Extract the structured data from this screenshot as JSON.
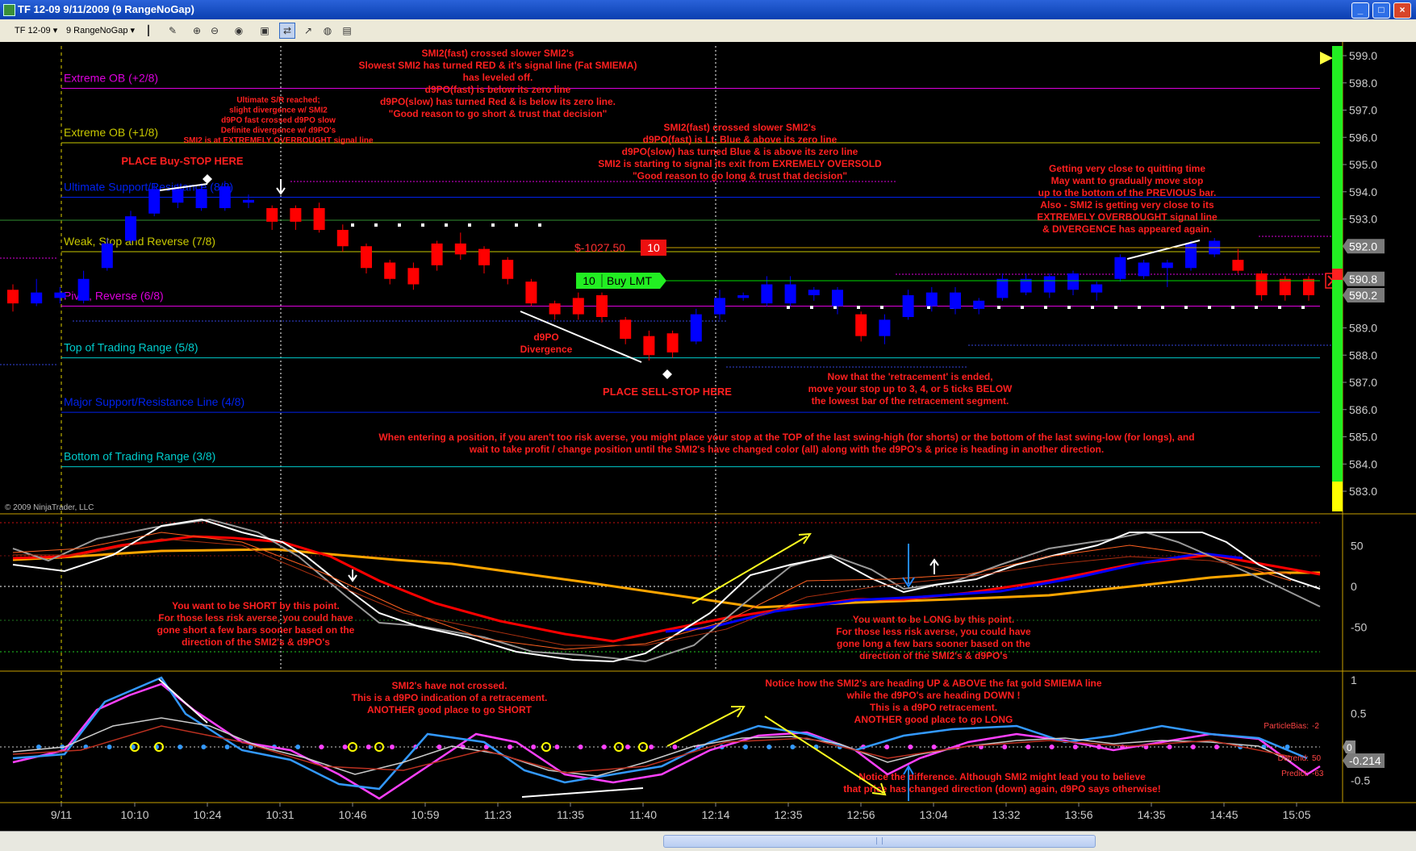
{
  "window": {
    "title": "TF 12-09  9/11/2009 (9 RangeNoGap)"
  },
  "toolbar": {
    "instrument": "TF 12-09",
    "period": "9 RangeNoGap"
  },
  "copyright": "© 2009 NinjaTrader, LLC",
  "colors": {
    "bull": "#0000ff",
    "bear": "#ff0000",
    "annotation": "#ff2020",
    "orange_ma": "#ffa500"
  },
  "price_axis": {
    "ticks": [
      "599.0",
      "598.0",
      "597.0",
      "596.0",
      "595.0",
      "594.0",
      "593.0",
      "592.0",
      "591.0",
      "590.0",
      "589.0",
      "588.0",
      "587.0",
      "586.0",
      "585.0",
      "584.0",
      "583.0"
    ],
    "min": 582.5,
    "max": 599.5
  },
  "price_tags": [
    {
      "label": "592.0",
      "price": 592.0,
      "style": "gray"
    },
    {
      "label": "590.8",
      "price": 590.8,
      "style": "gray"
    },
    {
      "label": "590.2",
      "price": 590.2,
      "style": "gray"
    }
  ],
  "murrey_lines": [
    {
      "label": "Extreme OB (+2/8)",
      "price": 597.8,
      "color": "#dd00dd"
    },
    {
      "label": "Extreme OB (+1/8)",
      "price": 595.8,
      "color": "#c8c800"
    },
    {
      "label": "Ultimate Support/Resistance (8/8)",
      "price": 593.8,
      "color": "#0022ee"
    },
    {
      "label": "Weak, Stop and Reverse (7/8)",
      "price": 591.8,
      "color": "#c8c800"
    },
    {
      "label": "Pivot, Reverse (6/8)",
      "price": 589.8,
      "color": "#dd00dd"
    },
    {
      "label": "Top of Trading Range (5/8)",
      "price": 587.9,
      "color": "#00cccc"
    },
    {
      "label": "Major Support/Resistance Line (4/8)",
      "price": 585.9,
      "color": "#0022ee"
    },
    {
      "label": "Bottom of Trading Range (3/8)",
      "price": 583.9,
      "color": "#00cccc"
    }
  ],
  "order_markers": {
    "position_pnl": "$-1027.50",
    "position_qty": "10",
    "order_qty": "10",
    "order_label": "Buy LMT"
  },
  "time_axis": [
    "9/11",
    "10:10",
    "10:24",
    "10:31",
    "10:46",
    "10:59",
    "11:23",
    "11:35",
    "11:40",
    "12:14",
    "12:35",
    "12:56",
    "13:04",
    "13:32",
    "13:56",
    "14:35",
    "14:45",
    "15:05"
  ],
  "bars": [
    {
      "o": 590.4,
      "c": 589.9,
      "h": 590.6,
      "l": 589.6
    },
    {
      "o": 589.9,
      "c": 590.3,
      "h": 590.8,
      "l": 589.8
    },
    {
      "o": 590.1,
      "c": 590.3,
      "h": 590.5,
      "l": 589.9
    },
    {
      "o": 590.0,
      "c": 590.8,
      "h": 591.1,
      "l": 589.9
    },
    {
      "o": 591.2,
      "c": 592.1,
      "h": 592.3,
      "l": 591.1
    },
    {
      "o": 592.2,
      "c": 593.1,
      "h": 593.3,
      "l": 592.1
    },
    {
      "o": 593.2,
      "c": 594.1,
      "h": 594.3,
      "l": 593.1
    },
    {
      "o": 593.6,
      "c": 594.1,
      "h": 594.3,
      "l": 593.4
    },
    {
      "o": 593.4,
      "c": 594.1,
      "h": 594.3,
      "l": 593.3
    },
    {
      "o": 593.4,
      "c": 594.2,
      "h": 594.4,
      "l": 593.3
    },
    {
      "o": 593.6,
      "c": 593.7,
      "h": 593.9,
      "l": 593.4
    },
    {
      "o": 593.4,
      "c": 592.9,
      "h": 593.5,
      "l": 592.6
    },
    {
      "o": 593.4,
      "c": 592.9,
      "h": 593.5,
      "l": 592.6
    },
    {
      "o": 593.4,
      "c": 592.6,
      "h": 593.6,
      "l": 592.5
    },
    {
      "o": 592.6,
      "c": 592.0,
      "h": 592.8,
      "l": 591.8
    },
    {
      "o": 592.0,
      "c": 591.2,
      "h": 592.1,
      "l": 591.0
    },
    {
      "o": 591.4,
      "c": 590.8,
      "h": 591.5,
      "l": 590.6
    },
    {
      "o": 591.2,
      "c": 590.6,
      "h": 591.4,
      "l": 590.4
    },
    {
      "o": 592.1,
      "c": 591.3,
      "h": 592.2,
      "l": 591.1
    },
    {
      "o": 592.1,
      "c": 591.7,
      "h": 592.5,
      "l": 591.5
    },
    {
      "o": 591.9,
      "c": 591.3,
      "h": 592.0,
      "l": 591.0
    },
    {
      "o": 591.5,
      "c": 590.8,
      "h": 591.6,
      "l": 590.6
    },
    {
      "o": 590.7,
      "c": 589.9,
      "h": 590.8,
      "l": 589.8
    },
    {
      "o": 589.9,
      "c": 589.5,
      "h": 590.0,
      "l": 589.3
    },
    {
      "o": 590.1,
      "c": 589.5,
      "h": 590.3,
      "l": 589.3
    },
    {
      "o": 590.2,
      "c": 589.4,
      "h": 590.3,
      "l": 589.2
    },
    {
      "o": 589.3,
      "c": 588.6,
      "h": 589.4,
      "l": 588.4
    },
    {
      "o": 588.7,
      "c": 588.0,
      "h": 588.9,
      "l": 587.8
    },
    {
      "o": 588.8,
      "c": 588.1,
      "h": 588.9,
      "l": 587.9
    },
    {
      "o": 588.5,
      "c": 589.5,
      "h": 589.7,
      "l": 588.4
    },
    {
      "o": 589.5,
      "c": 590.1,
      "h": 590.4,
      "l": 589.3
    },
    {
      "o": 590.1,
      "c": 590.2,
      "h": 590.3,
      "l": 590.0
    },
    {
      "o": 589.9,
      "c": 590.6,
      "h": 590.9,
      "l": 589.8
    },
    {
      "o": 589.9,
      "c": 590.6,
      "h": 590.9,
      "l": 589.8
    },
    {
      "o": 590.2,
      "c": 590.4,
      "h": 590.5,
      "l": 590.0
    },
    {
      "o": 589.8,
      "c": 590.4,
      "h": 590.5,
      "l": 589.5
    },
    {
      "o": 589.5,
      "c": 588.7,
      "h": 589.6,
      "l": 588.5
    },
    {
      "o": 588.7,
      "c": 589.3,
      "h": 589.5,
      "l": 588.4
    },
    {
      "o": 589.4,
      "c": 590.2,
      "h": 590.4,
      "l": 589.3
    },
    {
      "o": 589.8,
      "c": 590.3,
      "h": 590.5,
      "l": 589.6
    },
    {
      "o": 589.7,
      "c": 590.3,
      "h": 590.5,
      "l": 589.5
    },
    {
      "o": 589.7,
      "c": 590.0,
      "h": 590.1,
      "l": 589.5
    },
    {
      "o": 590.1,
      "c": 590.8,
      "h": 591.0,
      "l": 590.0
    },
    {
      "o": 590.3,
      "c": 590.8,
      "h": 591.0,
      "l": 590.2
    },
    {
      "o": 590.3,
      "c": 590.9,
      "h": 591.0,
      "l": 590.1
    },
    {
      "o": 590.4,
      "c": 591.0,
      "h": 591.1,
      "l": 590.2
    },
    {
      "o": 590.3,
      "c": 590.6,
      "h": 590.7,
      "l": 590.0
    },
    {
      "o": 590.8,
      "c": 591.6,
      "h": 591.7,
      "l": 590.7
    },
    {
      "o": 590.9,
      "c": 591.4,
      "h": 591.5,
      "l": 590.8
    },
    {
      "o": 591.2,
      "c": 591.4,
      "h": 591.5,
      "l": 590.5
    },
    {
      "o": 591.2,
      "c": 592.1,
      "h": 592.2,
      "l": 591.1
    },
    {
      "o": 591.7,
      "c": 592.2,
      "h": 592.3,
      "l": 591.6
    },
    {
      "o": 591.5,
      "c": 591.1,
      "h": 591.9,
      "l": 591.0
    },
    {
      "o": 591.0,
      "c": 590.2,
      "h": 591.1,
      "l": 590.0
    },
    {
      "o": 590.8,
      "c": 590.2,
      "h": 590.9,
      "l": 590.0
    },
    {
      "o": 590.8,
      "c": 590.2,
      "h": 590.9,
      "l": 590.0
    }
  ],
  "annotations": [
    {
      "id": "ann-smi-cross-top",
      "lines": [
        "SMI2(fast) crossed slower SMI2's",
        "Slowest SMI2 has turned RED & it's signal line (Fat SMIEMA)",
        "has leveled off.",
        "d9PO(fast) is below its zero line",
        "d9PO(slow) has turned Red & is below its zero line.",
        "\"Good reason to go short & trust that decision\""
      ]
    },
    {
      "id": "ann-ultimate-sr",
      "lines": [
        "Ultimate S/R reached;",
        "slight divergence w/ SMI2",
        "d9PO fast crossed d9PO slow",
        "Definite divergence w/ d9PO's",
        "SMI2 is at EXTREMELY OVERBOUGHT signal line"
      ]
    },
    {
      "id": "ann-buy-stop",
      "lines": [
        "PLACE Buy-STOP HERE"
      ]
    },
    {
      "id": "ann-smi-cross-long",
      "lines": [
        "SMI2(fast) crossed slower SMI2's",
        "d9PO(fast) is Lt. Blue & above its zero line",
        "d9PO(slow) has turned Blue & is above its zero line",
        "SMI2 is starting to signal its exit from EXREMELY OVERSOLD",
        "\"Good reason to go long & trust that decision\""
      ]
    },
    {
      "id": "ann-quitting-time",
      "lines": [
        "Getting very close to quitting time",
        "May want to gradually move stop",
        "up to the bottom of the PREVIOUS bar.",
        "Also - SMI2 is getting very close to its",
        "EXTREMELY OVERBOUGHT signal line",
        "& DIVERGENCE has appeared again."
      ]
    },
    {
      "id": "ann-d9po-div",
      "lines": [
        "d9PO",
        "Divergence"
      ]
    },
    {
      "id": "ann-sell-stop",
      "lines": [
        "PLACE SELL-STOP HERE"
      ]
    },
    {
      "id": "ann-retrace-ended",
      "lines": [
        "Now that the 'retracement' is ended,",
        "move your stop up to 3, 4, or 5 ticks BELOW",
        "the lowest bar of the retracement segment."
      ]
    },
    {
      "id": "ann-risk",
      "lines": [
        "When entering a position, if you aren't too risk averse, you might place your stop at the TOP of the last swing-high (for shorts) or the bottom of the last swing-low (for longs), and",
        "wait to take profit / change position until the SMI2's have changed color (all) along with the d9PO's & price is heading in another direction."
      ]
    },
    {
      "id": "ann-short",
      "lines": [
        "You want to be SHORT by this point.",
        "For those less risk averse, you could have",
        "gone short a few bars sooner based on the",
        "direction of the SMI2's & d9PO's"
      ]
    },
    {
      "id": "ann-long",
      "lines": [
        "You want to be LONG by this point.",
        "For those less risk averse, you could have",
        "gone long a few bars sooner based on the",
        "direction of the SMI2's & d9PO's"
      ]
    },
    {
      "id": "ann-not-crossed",
      "lines": [
        "SMI2's have not crossed.",
        "This is a d9PO indication of a retracement.",
        "ANOTHER good place to go SHORT"
      ]
    },
    {
      "id": "ann-notice-up",
      "lines": [
        "Notice how the SMI2's are heading UP & ABOVE the fat gold SMIEMA line",
        "while the d9PO's are heading DOWN !",
        "This is a d9PO retracement.",
        "ANOTHER good place to go LONG"
      ]
    },
    {
      "id": "ann-difference",
      "lines": [
        "Notice the difference. Although SMI2 might lead you to believe",
        "that price has changed direction (down) again, d9PO says otherwise!"
      ]
    }
  ],
  "panel2": {
    "ticks": [
      "50",
      "0",
      "-50"
    ]
  },
  "panel3": {
    "ticks": [
      "1",
      "0.5",
      "-0.5"
    ],
    "current_value": "-0.214",
    "current_tag_left": "0",
    "labels": [
      {
        "text": "ParticleBias:",
        "value": "-2"
      },
      {
        "text": "Detrend:",
        "value": "50"
      },
      {
        "text": "Predict:",
        "value": "-63"
      }
    ]
  }
}
